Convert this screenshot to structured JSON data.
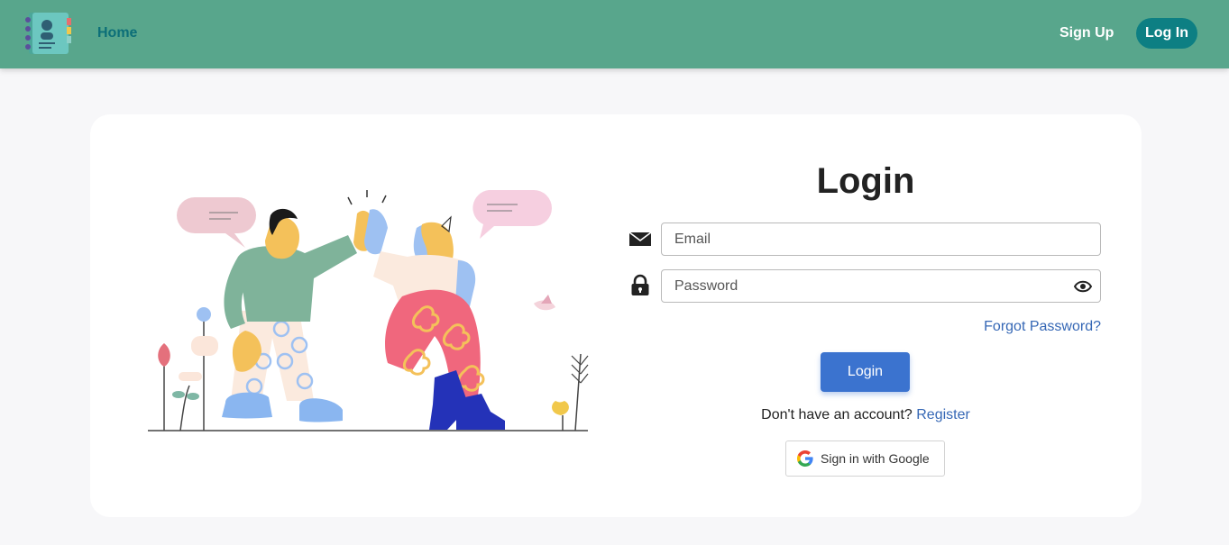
{
  "navbar": {
    "logo_icon": "address-book-icon",
    "home_label": "Home",
    "signup_label": "Sign Up",
    "login_label": "Log In"
  },
  "form": {
    "title": "Login",
    "email_placeholder": "Email",
    "email_icon": "envelope-icon",
    "password_placeholder": "Password",
    "password_icon": "lock-icon",
    "toggle_icon": "eye-icon",
    "forgot_label": "Forgot Password?",
    "submit_label": "Login",
    "register_prompt": "Don't have an account?",
    "register_link": "Register",
    "google_label": "Sign in with Google",
    "google_icon": "google-g-icon"
  },
  "illustration": {
    "icon": "high-five-illustration"
  },
  "colors": {
    "navbar_bg": "#58a68c",
    "nav_home_text": "#0c6f78",
    "nav_login_bg": "#0d7f83",
    "primary_button": "#3b73cf",
    "link": "#3567b5",
    "page_bg": "#f7f7f9"
  }
}
